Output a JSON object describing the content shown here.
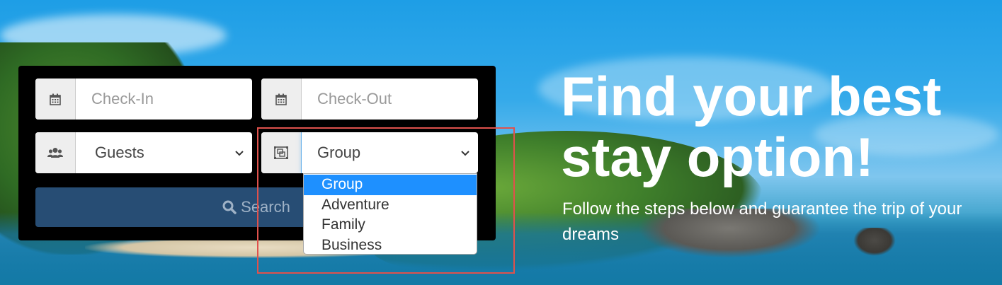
{
  "form": {
    "checkin_placeholder": "Check-In",
    "checkout_placeholder": "Check-Out",
    "guests_value": "Guests",
    "group_value": "Group",
    "search_label": "Search"
  },
  "dropdown": {
    "options": [
      "Group",
      "Adventure",
      "Family",
      "Business"
    ],
    "selected": "Group"
  },
  "hero": {
    "title": "Find your best stay option!",
    "subtitle": "Follow the steps below and guarantee the trip of your dreams"
  },
  "icons": {
    "checkin": "calendar-icon",
    "checkout": "calendar-icon",
    "guests": "users-icon",
    "group": "object-group-icon",
    "search": "search-icon",
    "chevron": "chevron-down-icon"
  },
  "colors": {
    "panel_bg": "#000000",
    "search_button": "#274d74",
    "selected_option": "#1e90ff",
    "highlight_box": "#e0514c"
  }
}
